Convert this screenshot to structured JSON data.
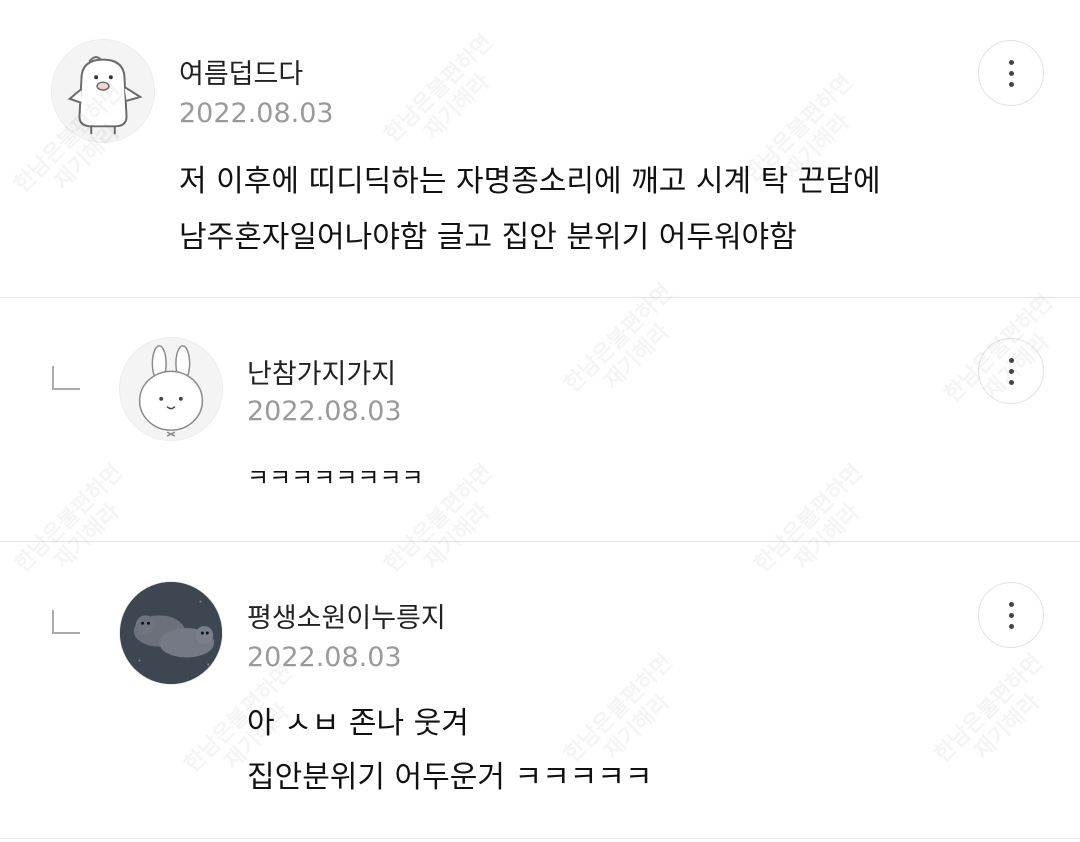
{
  "comments": [
    {
      "username": "여름덥드다",
      "date": "2022.08.03",
      "lines": [
        "저 이후에 띠디딕하는 자명종소리에 깨고 시계 탁 끈담에",
        "남주혼자일어나야함 글고 집안 분위기 어두워야함"
      ],
      "avatar_icon": "penguin-avatar-icon",
      "is_reply": false
    },
    {
      "username": "난참가지가지",
      "date": "2022.08.03",
      "lines": [
        "ㅋㅋㅋㅋㅋㅋㅋㅋ"
      ],
      "avatar_icon": "rabbit-avatar-icon",
      "is_reply": true
    },
    {
      "username": "평생소원이누릉지",
      "date": "2022.08.03",
      "lines": [
        "아 ㅅㅂ 존나 웃겨",
        "집안분위기 어두운거 ㅋㅋㅋㅋㅋ"
      ],
      "avatar_icon": "seal-avatar-icon",
      "is_reply": true
    }
  ],
  "icons": {
    "more": "more-vertical-icon",
    "reply": "reply-indent-icon"
  },
  "watermark": {
    "line1": "한남은불편하면",
    "line2": "재기해라"
  },
  "colors": {
    "username": "#222222",
    "date": "#9a9a9a",
    "text": "#111111",
    "divider": "#e6e6e6"
  }
}
